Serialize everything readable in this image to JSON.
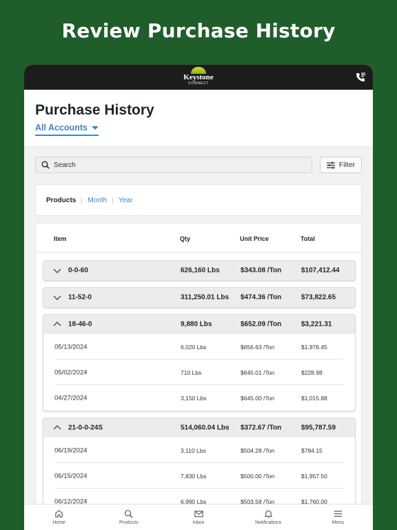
{
  "headline": "Review Purchase History",
  "logo": {
    "name": "Keystone",
    "sub": "CONNECT"
  },
  "page_title": "Purchase History",
  "accounts_label": "All Accounts",
  "search": {
    "placeholder": "Search"
  },
  "filter_label": "Filter",
  "tabs": [
    {
      "label": "Products",
      "active": true
    },
    {
      "label": "Month"
    },
    {
      "label": "Year"
    }
  ],
  "table": {
    "columns": [
      "Item",
      "Qty",
      "Unit Price",
      "Total"
    ],
    "groups": [
      {
        "item": "0-0-60",
        "qty": "626,160 Lbs",
        "price": "$343.08 /Ton",
        "total": "$107,412.44",
        "expanded": false,
        "rows": []
      },
      {
        "item": "11-52-0",
        "qty": "311,250.01 Lbs",
        "price": "$474.36 /Ton",
        "total": "$73,822.65",
        "expanded": false,
        "rows": []
      },
      {
        "item": "18-46-0",
        "qty": "9,880 Lbs",
        "price": "$652.09 /Ton",
        "total": "$3,221.31",
        "expanded": true,
        "rows": [
          {
            "date": "05/13/2024",
            "qty": "6,020 Lbs",
            "price": "$656.63 /Ton",
            "total": "$1,976.45"
          },
          {
            "date": "05/02/2024",
            "qty": "710 Lbs",
            "price": "$645.01 /Ton",
            "total": "$228.98"
          },
          {
            "date": "04/27/2024",
            "qty": "3,150 Lbs",
            "price": "$645.00 /Ton",
            "total": "$1,015.88"
          }
        ]
      },
      {
        "item": "21-0-0-24S",
        "qty": "514,060.04 Lbs",
        "price": "$372.67 /Ton",
        "total": "$95,787.59",
        "expanded": true,
        "rows": [
          {
            "date": "06/19/2024",
            "qty": "3,110 Lbs",
            "price": "$504.28 /Ton",
            "total": "$784.15"
          },
          {
            "date": "06/15/2024",
            "qty": "7,830 Lbs",
            "price": "$500.00 /Ton",
            "total": "$1,957.50"
          },
          {
            "date": "06/12/2024",
            "qty": "6,990 Lbs",
            "price": "$503.58 /Ton",
            "total": "$1,760.00"
          }
        ]
      }
    ]
  },
  "nav": [
    {
      "label": "Home",
      "icon": "home-icon"
    },
    {
      "label": "Products",
      "icon": "search-icon"
    },
    {
      "label": "Inbox",
      "icon": "mail-icon"
    },
    {
      "label": "Notifications",
      "icon": "bell-icon"
    },
    {
      "label": "Menu",
      "icon": "menu-icon"
    }
  ],
  "colors": {
    "background": "#1f5e2a",
    "accent": "#3a86c5",
    "topbar": "#1c1c1c"
  }
}
